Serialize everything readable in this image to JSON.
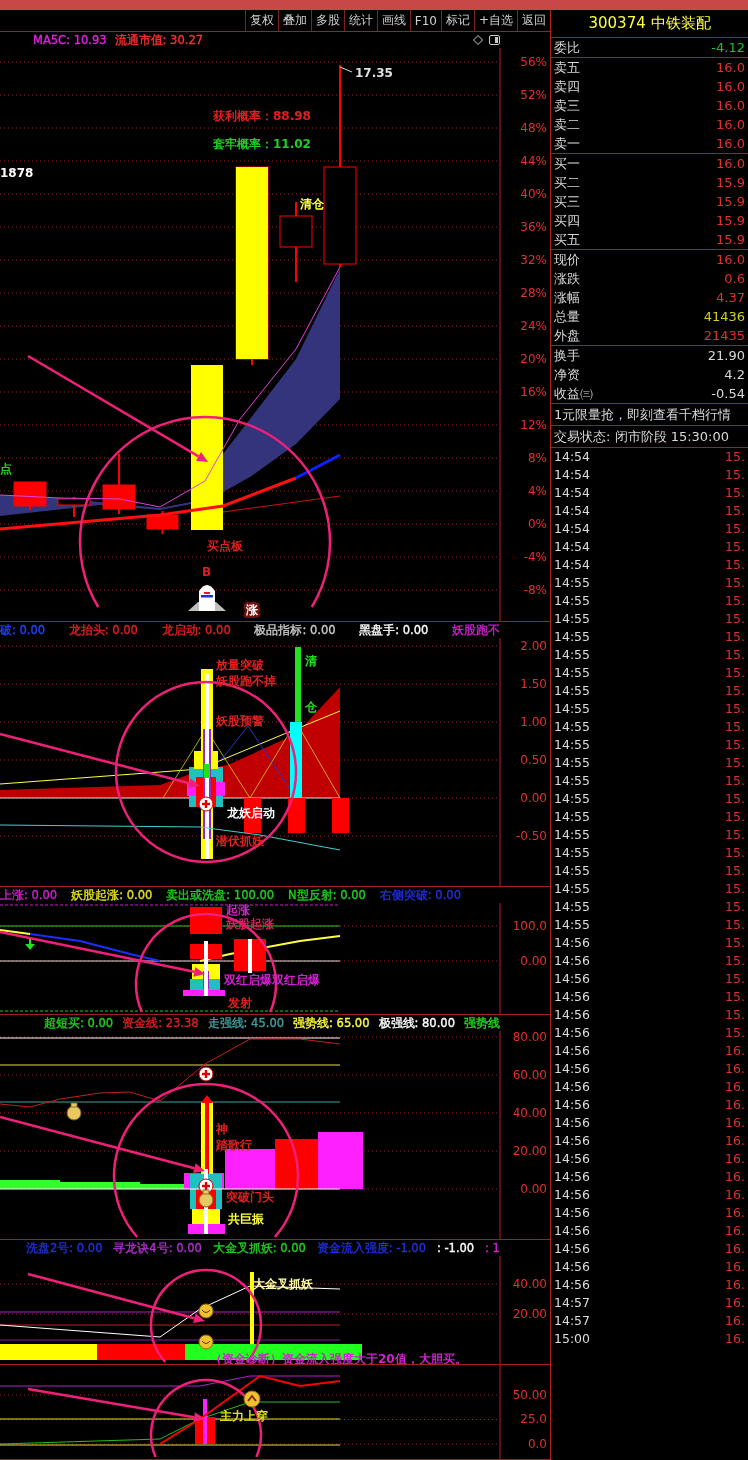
{
  "toolbar": {
    "buttons": [
      "复权",
      "叠加",
      "多股",
      "统计",
      "画线",
      "F10",
      "标记",
      "+自选",
      "返回"
    ]
  },
  "quote": {
    "title": "300374 中铁装配",
    "summary": [
      {
        "label": "委比",
        "value": "-4.12",
        "color": "#20c020"
      }
    ],
    "sell": [
      {
        "label": "卖五",
        "value": "16.0",
        "color": "#e03030"
      },
      {
        "label": "卖四",
        "value": "16.0",
        "color": "#e03030"
      },
      {
        "label": "卖三",
        "value": "16.0",
        "color": "#e03030"
      },
      {
        "label": "卖二",
        "value": "16.0",
        "color": "#e03030"
      },
      {
        "label": "卖一",
        "value": "16.0",
        "color": "#e03030"
      }
    ],
    "buy": [
      {
        "label": "买一",
        "value": "16.0",
        "color": "#e03030"
      },
      {
        "label": "买二",
        "value": "15.9",
        "color": "#e03030"
      },
      {
        "label": "买三",
        "value": "15.9",
        "color": "#e03030"
      },
      {
        "label": "买四",
        "value": "15.9",
        "color": "#e03030"
      },
      {
        "label": "买五",
        "value": "15.9",
        "color": "#e03030"
      }
    ],
    "stats": [
      {
        "label": "现价",
        "value": "16.0",
        "color": "#e03030"
      },
      {
        "label": "涨跌",
        "value": "0.6",
        "color": "#e03030"
      },
      {
        "label": "涨幅",
        "value": "4.37",
        "color": "#e03030"
      },
      {
        "label": "总量",
        "value": "41436",
        "color": "#d0d020"
      },
      {
        "label": "外盘",
        "value": "21435",
        "color": "#e03030"
      }
    ],
    "extra": [
      {
        "label": "换手",
        "value": "21.90",
        "color": "#d8d8d8"
      },
      {
        "label": "净资",
        "value": "4.2",
        "color": "#d8d8d8"
      },
      {
        "label": "收益㈢",
        "value": "-0.54",
        "color": "#d8d8d8"
      }
    ],
    "banner": "1元限量抢，即刻查看千档行情",
    "status": "交易状态: 闭市阶段 15:30:00",
    "ticks": [
      {
        "time": "14:54",
        "price": "15."
      },
      {
        "time": "14:54",
        "price": "15."
      },
      {
        "time": "14:54",
        "price": "15."
      },
      {
        "time": "14:54",
        "price": "15."
      },
      {
        "time": "14:54",
        "price": "15."
      },
      {
        "time": "14:54",
        "price": "15."
      },
      {
        "time": "14:54",
        "price": "15."
      },
      {
        "time": "14:55",
        "price": "15."
      },
      {
        "time": "14:55",
        "price": "15."
      },
      {
        "time": "14:55",
        "price": "15."
      },
      {
        "time": "14:55",
        "price": "15."
      },
      {
        "time": "14:55",
        "price": "15."
      },
      {
        "time": "14:55",
        "price": "15."
      },
      {
        "time": "14:55",
        "price": "15."
      },
      {
        "time": "14:55",
        "price": "15."
      },
      {
        "time": "14:55",
        "price": "15."
      },
      {
        "time": "14:55",
        "price": "15."
      },
      {
        "time": "14:55",
        "price": "15."
      },
      {
        "time": "14:55",
        "price": "15."
      },
      {
        "time": "14:55",
        "price": "15."
      },
      {
        "time": "14:55",
        "price": "15."
      },
      {
        "time": "14:55",
        "price": "15."
      },
      {
        "time": "14:55",
        "price": "15."
      },
      {
        "time": "14:55",
        "price": "15."
      },
      {
        "time": "14:55",
        "price": "15."
      },
      {
        "time": "14:55",
        "price": "15."
      },
      {
        "time": "14:55",
        "price": "15."
      },
      {
        "time": "14:56",
        "price": "15."
      },
      {
        "time": "14:56",
        "price": "15."
      },
      {
        "time": "14:56",
        "price": "15."
      },
      {
        "time": "14:56",
        "price": "15."
      },
      {
        "time": "14:56",
        "price": "15."
      },
      {
        "time": "14:56",
        "price": "15."
      },
      {
        "time": "14:56",
        "price": "16."
      },
      {
        "time": "14:56",
        "price": "16."
      },
      {
        "time": "14:56",
        "price": "16."
      },
      {
        "time": "14:56",
        "price": "16."
      },
      {
        "time": "14:56",
        "price": "16."
      },
      {
        "time": "14:56",
        "price": "16."
      },
      {
        "time": "14:56",
        "price": "16."
      },
      {
        "time": "14:56",
        "price": "16."
      },
      {
        "time": "14:56",
        "price": "16."
      },
      {
        "time": "14:56",
        "price": "16."
      },
      {
        "time": "14:56",
        "price": "16."
      },
      {
        "time": "14:56",
        "price": "16."
      },
      {
        "time": "14:56",
        "price": "16."
      },
      {
        "time": "14:56",
        "price": "16."
      },
      {
        "time": "14:57",
        "price": "16."
      },
      {
        "time": "14:57",
        "price": "16."
      },
      {
        "time": "15:00",
        "price": "16."
      }
    ]
  },
  "panels": [
    {
      "kind": "price",
      "legend": [
        {
          "text": "MA5C: 10.93",
          "color": "#e020e0"
        },
        {
          "text": "流通市值: 30.27",
          "color": "#ff3030"
        }
      ],
      "axis_labels": [
        "56%",
        "52%",
        "48%",
        "44%",
        "40%",
        "36%",
        "32%",
        "28%",
        "24%",
        "20%",
        "16%",
        "12%",
        "8%",
        "4%",
        "0%",
        "-4%",
        "-8%"
      ],
      "annotations": [
        {
          "text": "17.35",
          "color": "#e0e0e0"
        },
        {
          "text": "获利概率：88.98",
          "color": "#e02020"
        },
        {
          "text": "套牢概率：11.02",
          "color": "#20d020"
        },
        {
          "text": "1878",
          "color": "#ffffff"
        },
        {
          "text": "清仓",
          "color": "#ffff40"
        },
        {
          "text": "点",
          "color": "#20d020"
        },
        {
          "text": "买点板",
          "color": "#e02020"
        },
        {
          "text": "B",
          "color": "#e02020"
        },
        {
          "text": "涨",
          "color": "#ffffff"
        }
      ]
    },
    {
      "kind": "dragon",
      "legend": [
        {
          "text": "破: 0.00",
          "color": "#2040ff"
        },
        {
          "text": "龙抬头: 0.00",
          "color": "#e02020"
        },
        {
          "text": "龙启动: 0.00",
          "color": "#e02020"
        },
        {
          "text": "极品指标: 0.00",
          "color": "#c8c8c8"
        },
        {
          "text": "黑盘手: 0.00",
          "color": "#ffffff"
        },
        {
          "text": "妖股跑不",
          "color": "#d020d0"
        }
      ],
      "axis_labels": [
        "2.00",
        "1.50",
        "1.00",
        "0.50",
        "0.00",
        "-0.50"
      ],
      "annotations": [
        {
          "text": "放量突破",
          "color": "#e02020"
        },
        {
          "text": "妖股跑不掉",
          "color": "#e02020"
        },
        {
          "text": "妖股预警",
          "color": "#e02020"
        },
        {
          "text": "龙妖启动",
          "color": "#ffffff"
        },
        {
          "text": "潜伏抓妖",
          "color": "#e02020"
        },
        {
          "text": "清",
          "color": "#20e020"
        },
        {
          "text": "仓",
          "color": "#20e020"
        }
      ]
    },
    {
      "kind": "launch",
      "legend": [
        {
          "text": "上涨: 0.00",
          "color": "#d020d0"
        },
        {
          "text": "妖股起涨: 0.00",
          "color": "#e0e020"
        },
        {
          "text": "卖出或洗盘: 100.00",
          "color": "#20d020"
        },
        {
          "text": "N型反射: 0.00",
          "color": "#20d020"
        },
        {
          "text": "右侧突破: 0.00",
          "color": "#2030e0"
        }
      ],
      "axis_labels": [
        "100.0",
        "0.00"
      ],
      "annotations": [
        {
          "text": "起涨",
          "color": "#d020d0"
        },
        {
          "text": "妖股起涨",
          "color": "#d02060"
        },
        {
          "text": "双红启爆双红启爆",
          "color": "#d020d0"
        },
        {
          "text": "发射",
          "color": "#e02020"
        }
      ]
    },
    {
      "kind": "capital",
      "legend": [
        {
          "text": "超短买: 0.00",
          "color": "#20d020"
        },
        {
          "text": "资金线: 23.38",
          "color": "#e02020"
        },
        {
          "text": "走强线: 45.00",
          "color": "#40a0a0"
        },
        {
          "text": "强势线: 65.00",
          "color": "#ffff40"
        },
        {
          "text": "极强线: 80.00",
          "color": "#ffffff"
        },
        {
          "text": "强势线",
          "color": "#20e020"
        }
      ],
      "axis_labels": [
        "80.00",
        "60.00",
        "40.00",
        "20.00",
        "0.00"
      ],
      "annotations": [
        {
          "text": "神",
          "color": "#e02020"
        },
        {
          "text": "踏歌行",
          "color": "#e02020"
        },
        {
          "text": "突破门头",
          "color": "#e02020"
        },
        {
          "text": "共巨振",
          "color": "#ffff40"
        }
      ]
    },
    {
      "kind": "inflow",
      "legend": [
        {
          "text": "洗盘2号: 0.00",
          "color": "#2030e0"
        },
        {
          "text": "寻龙诀4号: 0.00",
          "color": "#b030d0"
        },
        {
          "text": "大金叉抓妖: 0.00",
          "color": "#20d020"
        },
        {
          "text": "资金流入强度: -1.00",
          "color": "#2030e0"
        },
        {
          "text": ": -1.00",
          "color": "#ffffff"
        },
        {
          "text": ": 1",
          "color": "#d020d0"
        }
      ],
      "axis_labels": [
        "40.00",
        "20.00"
      ],
      "annotations": [
        {
          "text": "大金叉抓妖",
          "color": "#ffffa0"
        },
        {
          "text": "（资金诊断）资金流入强度大于20值，大胆买。",
          "color": "#d020d0"
        }
      ]
    },
    {
      "kind": "mainforce",
      "axis_labels": [
        "50.00",
        "25.0",
        "0.0"
      ],
      "annotations": [
        {
          "text": "主力上穿",
          "color": "#e0e020"
        }
      ]
    }
  ]
}
